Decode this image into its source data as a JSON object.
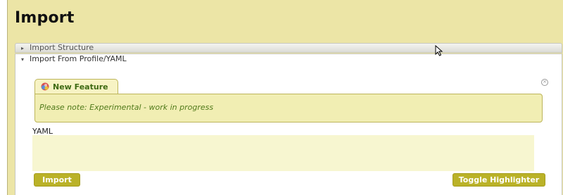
{
  "page": {
    "title": "Import"
  },
  "sections": {
    "import_structure": {
      "label": "Import Structure",
      "expanded": false,
      "arrow": "▸"
    },
    "import_profile": {
      "label": "Import From Profile/YAML",
      "expanded": true,
      "arrow": "▾"
    }
  },
  "notice": {
    "tab_label": "New Feature",
    "icon": "feature-icon",
    "message": "Please note: Experimental - work in progress",
    "close_symbol": "×"
  },
  "yaml": {
    "label": "YAML",
    "value": ""
  },
  "buttons": {
    "import": "Import",
    "toggle_highlighter": "Toggle Highlighter"
  },
  "colors": {
    "header_bg": "#ece5a6",
    "button_bg": "#bab228",
    "note_bg": "#f1eeb3",
    "note_text": "#507a1a",
    "yaml_bg": "#f7f6d0"
  }
}
